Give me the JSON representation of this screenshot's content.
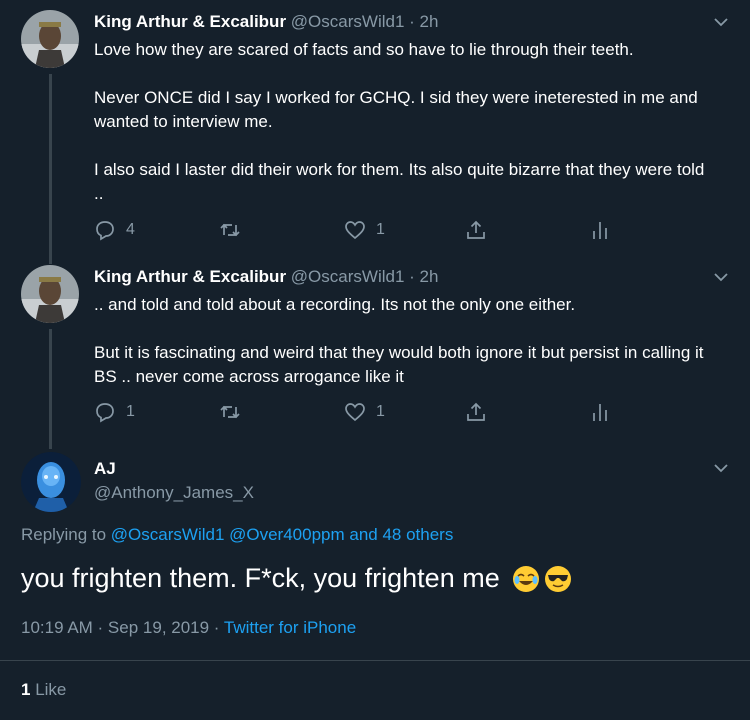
{
  "thread": [
    {
      "display_name": "King Arthur & Excalibur",
      "handle": "@OscarsWild1",
      "time": "· 2h",
      "paragraphs": [
        "Love how they are scared of facts and so have to lie through their teeth.",
        "Never ONCE did I say I worked for GCHQ. I sid they were ineterested in me and wanted to interview me.",
        "I also said I laster did their work for them. Its also quite bizarre that they were told .."
      ],
      "replies": "4",
      "retweets": "",
      "likes": "1"
    },
    {
      "display_name": "King Arthur & Excalibur",
      "handle": "@OscarsWild1",
      "time": "· 2h",
      "paragraphs": [
        ".. and told and told about a recording. Its not the only one either.",
        "But it is fascinating and weird that they would both ignore it but persist in calling it BS .. never come across arrogance like it"
      ],
      "replies": "1",
      "retweets": "",
      "likes": "1"
    }
  ],
  "main_tweet": {
    "display_name": "AJ",
    "handle": "@Anthony_James_X",
    "replying_prefix": "Replying to",
    "replying_users": "@OscarsWild1 @Over400ppm and 48 others",
    "text": "you frighten them. F*ck, you frighten me",
    "emojis": [
      "joy-emoji",
      "sunglasses-emoji"
    ],
    "timestamp": "10:19 AM · Sep 19, 2019 · ",
    "source": "Twitter for iPhone",
    "like_count": "1",
    "like_label": "Like"
  },
  "colors": {
    "background": "#15202b",
    "secondary_text": "#8899a6",
    "link": "#1da1f2",
    "divider": "#38444d"
  }
}
